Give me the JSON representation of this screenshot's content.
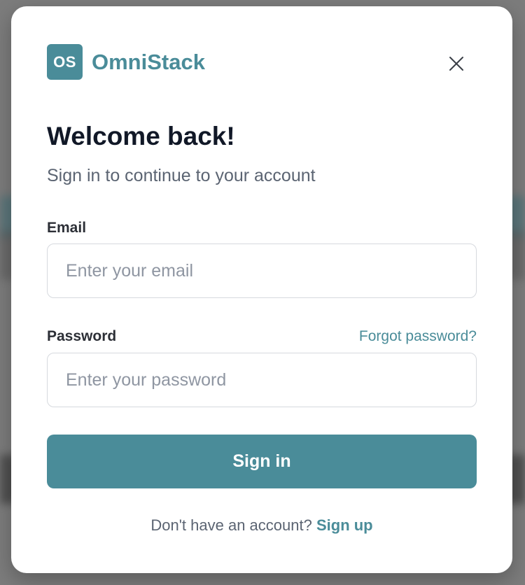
{
  "brand": {
    "logo_initials": "OS",
    "name": "OmniStack",
    "accent_color": "#4a8c99"
  },
  "modal": {
    "close_icon": "close-icon",
    "title": "Welcome back!",
    "subtitle": "Sign in to continue to your account"
  },
  "form": {
    "email": {
      "label": "Email",
      "placeholder": "Enter your email",
      "value": ""
    },
    "password": {
      "label": "Password",
      "placeholder": "Enter your password",
      "value": "",
      "forgot_link": "Forgot password?"
    },
    "submit_label": "Sign in"
  },
  "footer": {
    "prompt": "Don't have an account?",
    "signup_link": "Sign up"
  }
}
